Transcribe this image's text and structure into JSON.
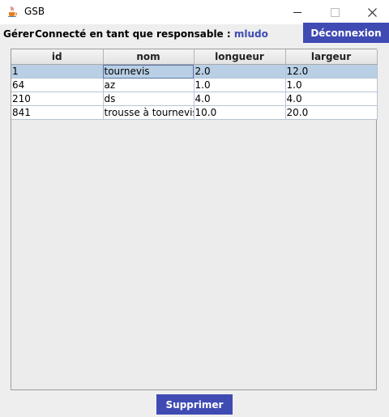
{
  "window": {
    "title": "GSB",
    "icon": "java-coffee-icon"
  },
  "menubar": {
    "gerer_label": "Gérer",
    "connection_prefix": "Connecté en tant que responsable : ",
    "user_name": "mludo",
    "logout_label": "Déconnexion"
  },
  "table": {
    "columns": [
      "id",
      "nom",
      "longueur",
      "largeur"
    ],
    "rows": [
      {
        "id": "1",
        "nom": "tournevis",
        "longueur": "2.0",
        "largeur": "12.0",
        "selected": true
      },
      {
        "id": "64",
        "nom": "az",
        "longueur": "1.0",
        "largeur": "1.0",
        "selected": false
      },
      {
        "id": "210",
        "nom": "ds",
        "longueur": "4.0",
        "largeur": "4.0",
        "selected": false
      },
      {
        "id": "841",
        "nom": "trousse à tournevis",
        "longueur": "10.0",
        "largeur": "20.0",
        "selected": false
      }
    ]
  },
  "actions": {
    "delete_label": "Supprimer"
  },
  "colors": {
    "accent": "#3f4ab3",
    "selection": "#b8cfe5"
  }
}
